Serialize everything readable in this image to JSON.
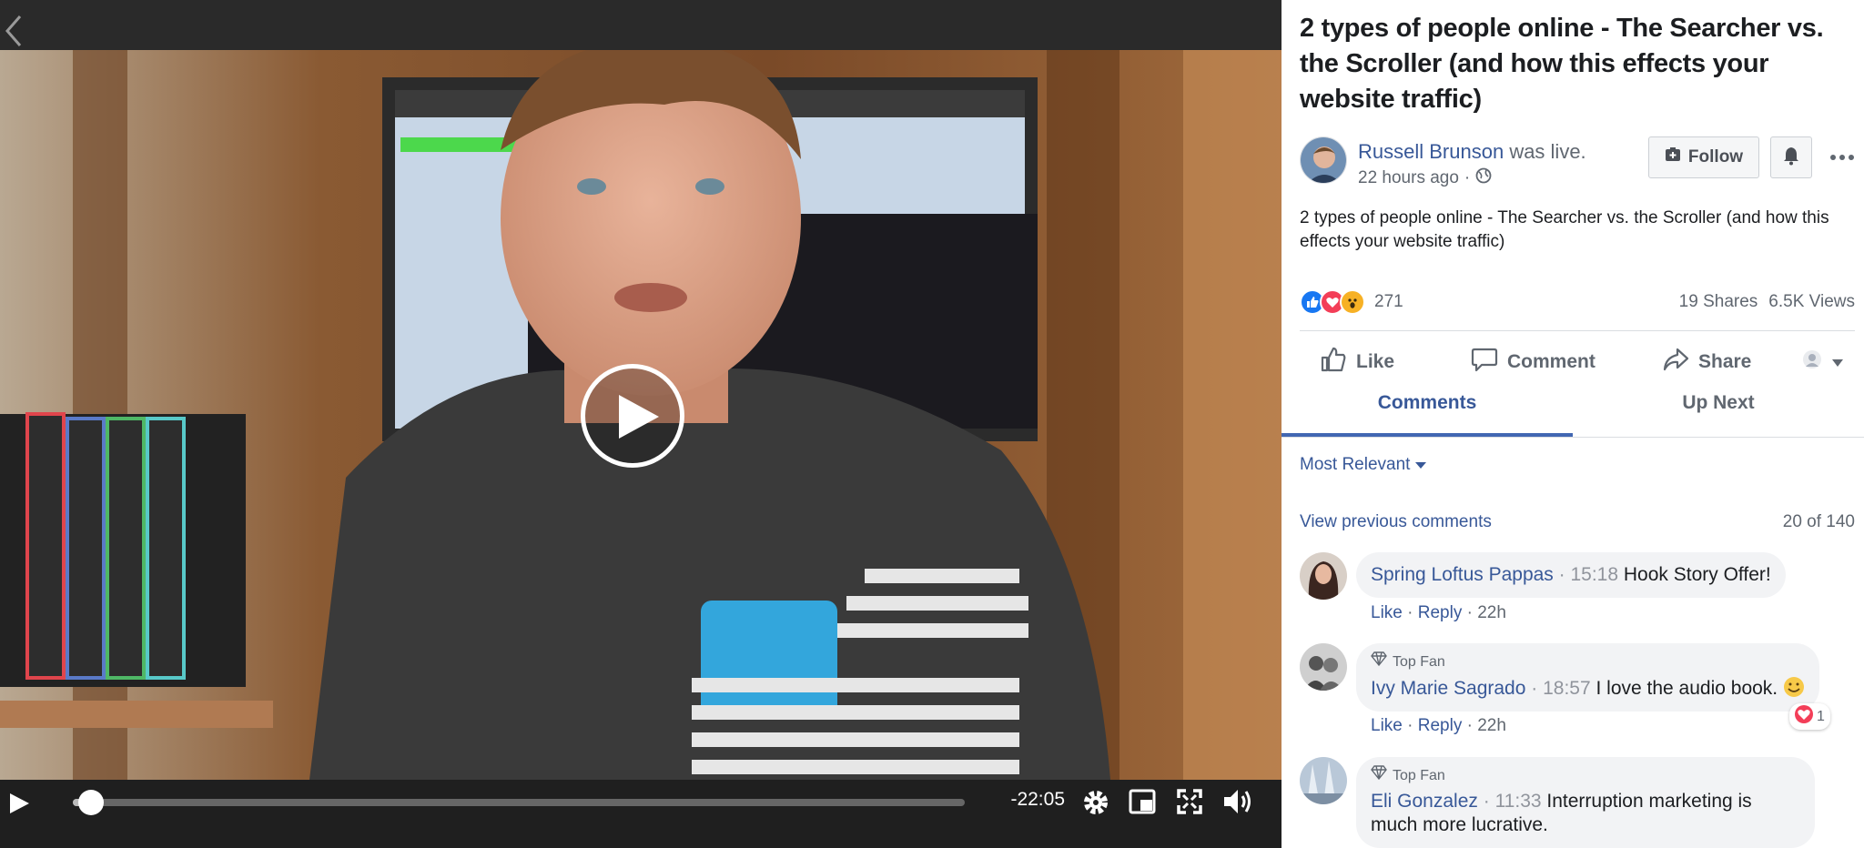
{
  "video": {
    "time_remaining": "-22:05",
    "progress_fraction": 0.02
  },
  "post": {
    "title": "2 types of people online - The Searcher vs. the Scroller (and how this effects your website traffic)",
    "author": "Russell Brunson",
    "author_suffix": "was live.",
    "timestamp": "22 hours ago",
    "separator": " · ",
    "follow_label": "Follow",
    "description": "2 types of people online - The Searcher vs. the Scroller (and how this effects your website traffic)",
    "reaction_count": "271",
    "shares": "19 Shares",
    "views": "6.5K Views",
    "accent": "#4267b2",
    "link_color": "#385898"
  },
  "actions": {
    "like": "Like",
    "comment": "Comment",
    "share": "Share"
  },
  "tabs": {
    "comments": "Comments",
    "up_next": "Up Next"
  },
  "comments_section": {
    "sort_label": "Most Relevant",
    "view_previous": "View previous comments",
    "count": "20 of 140",
    "items": [
      {
        "name": "Spring Loftus Pappas",
        "timestamp": "15:18",
        "text": "Hook Story Offer!",
        "like": "Like",
        "reply": "Reply",
        "age": "22h"
      },
      {
        "badge": "Top Fan",
        "name": "Ivy Marie Sagrado",
        "timestamp": "18:57",
        "text": "I love the audio book.",
        "like": "Like",
        "reply": "Reply",
        "age": "22h",
        "reactions": "1"
      },
      {
        "badge": "Top Fan",
        "name": "Eli Gonzalez",
        "timestamp": "11:33",
        "text": "Interruption marketing is much more lucrative."
      }
    ]
  }
}
